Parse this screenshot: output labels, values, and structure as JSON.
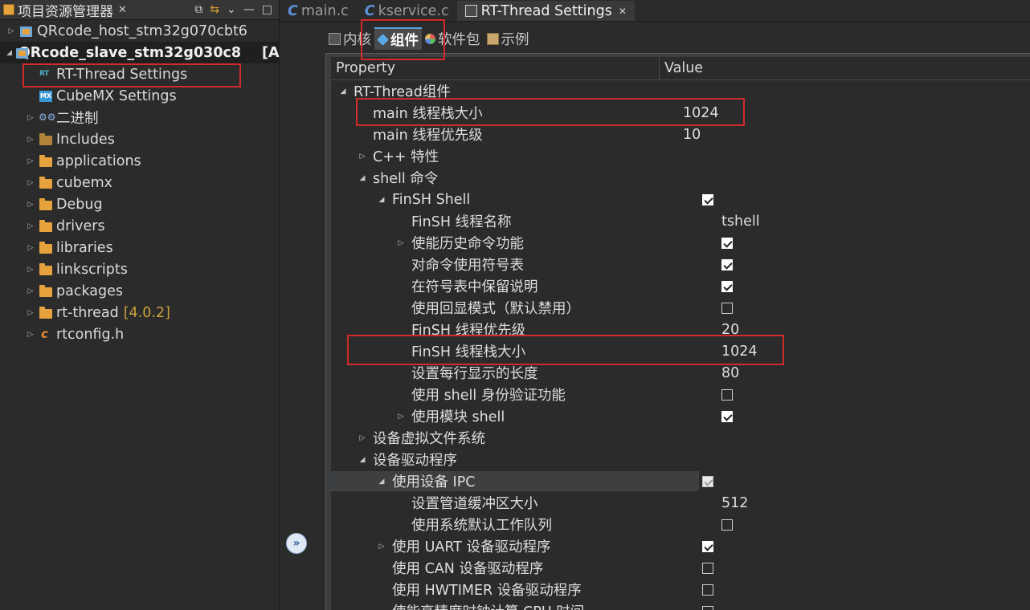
{
  "explorer": {
    "title": "项目资源管理器",
    "close_glyph": "✕",
    "items": [
      {
        "label": "QRcode_host_stm32g070cbt6",
        "kind": "project",
        "twisty": "▷",
        "bold": false
      },
      {
        "label": "QRcode_slave_stm32g030c8",
        "suffix": "[A",
        "kind": "project",
        "twisty": "◢",
        "bold": true
      },
      {
        "label": "RT-Thread Settings",
        "kind": "rt",
        "twisty": "",
        "bold": false
      },
      {
        "label": "CubeMX Settings",
        "kind": "mx",
        "twisty": "",
        "bold": false
      },
      {
        "label": "二进制",
        "kind": "binary",
        "twisty": "▷",
        "bold": false
      },
      {
        "label": "Includes",
        "kind": "folder-dark",
        "twisty": "▷",
        "bold": false
      },
      {
        "label": "applications",
        "kind": "folder",
        "twisty": "▷",
        "bold": false
      },
      {
        "label": "cubemx",
        "kind": "folder",
        "twisty": "▷",
        "bold": false
      },
      {
        "label": "Debug",
        "kind": "folder",
        "twisty": "▷",
        "bold": false
      },
      {
        "label": "drivers",
        "kind": "folder",
        "twisty": "▷",
        "bold": false
      },
      {
        "label": "libraries",
        "kind": "folder",
        "twisty": "▷",
        "bold": false
      },
      {
        "label": "linkscripts",
        "kind": "folder",
        "twisty": "▷",
        "bold": false
      },
      {
        "label": "packages",
        "kind": "folder",
        "twisty": "▷",
        "bold": false
      },
      {
        "label": "rt-thread",
        "version": "[4.0.2]",
        "kind": "folder",
        "twisty": "▷",
        "bold": false
      },
      {
        "label": "rtconfig.h",
        "kind": "cfile",
        "twisty": "▷",
        "bold": false
      }
    ]
  },
  "editor_tabs": [
    {
      "label": "main.c",
      "type": "c"
    },
    {
      "label": "kservice.c",
      "type": "c"
    },
    {
      "label": "RT-Thread Settings",
      "type": "settings",
      "close": "✕"
    }
  ],
  "sub_tabs": [
    {
      "label": "内核",
      "icon": "kernel"
    },
    {
      "label": "组件",
      "icon": "cube"
    },
    {
      "label": "软件包",
      "icon": "pkg"
    },
    {
      "label": "示例",
      "icon": "sample"
    }
  ],
  "table": {
    "col_property": "Property",
    "col_value": "Value",
    "rows": [
      {
        "label": "RT-Thread组件",
        "indent": 0,
        "twisty": "◢",
        "value": "",
        "check": null
      },
      {
        "label": "main 线程栈大小",
        "indent": 1,
        "twisty": "",
        "value": "1024",
        "check": null
      },
      {
        "label": "main 线程优先级",
        "indent": 1,
        "twisty": "",
        "value": "10",
        "check": null
      },
      {
        "label": "C++ 特性",
        "indent": 1,
        "twisty": "▷",
        "value": "",
        "check": null
      },
      {
        "label": "shell 命令",
        "indent": 1,
        "twisty": "◢",
        "value": "",
        "check": null
      },
      {
        "label": "FinSH Shell",
        "indent": 2,
        "twisty": "◢",
        "value": "",
        "check": "on"
      },
      {
        "label": "FinSH 线程名称",
        "indent": 3,
        "twisty": "",
        "value": "tshell",
        "check": null
      },
      {
        "label": "使能历史命令功能",
        "indent": 3,
        "twisty": "▷",
        "value": "",
        "check": "on"
      },
      {
        "label": "对命令使用符号表",
        "indent": 3,
        "twisty": "",
        "value": "",
        "check": "on"
      },
      {
        "label": "在符号表中保留说明",
        "indent": 3,
        "twisty": "",
        "value": "",
        "check": "on"
      },
      {
        "label": "使用回显模式（默认禁用）",
        "indent": 3,
        "twisty": "",
        "value": "",
        "check": "off"
      },
      {
        "label": "FinSH 线程优先级",
        "indent": 3,
        "twisty": "",
        "value": "20",
        "check": null
      },
      {
        "label": "FinSH 线程栈大小",
        "indent": 3,
        "twisty": "",
        "value": "1024",
        "check": null
      },
      {
        "label": "设置每行显示的长度",
        "indent": 3,
        "twisty": "",
        "value": "80",
        "check": null
      },
      {
        "label": "使用 shell 身份验证功能",
        "indent": 3,
        "twisty": "",
        "value": "",
        "check": "off"
      },
      {
        "label": "使用模块 shell",
        "indent": 3,
        "twisty": "▷",
        "value": "",
        "check": "on"
      },
      {
        "label": "设备虚拟文件系统",
        "indent": 1,
        "twisty": "▷",
        "value": "",
        "check": null
      },
      {
        "label": "设备驱动程序",
        "indent": 1,
        "twisty": "◢",
        "value": "",
        "check": null
      },
      {
        "label": "使用设备 IPC",
        "indent": 2,
        "twisty": "◢",
        "value": "",
        "check": "disabled",
        "highlight": true
      },
      {
        "label": "设置管道缓冲区大小",
        "indent": 3,
        "twisty": "",
        "value": "512",
        "check": null
      },
      {
        "label": "使用系统默认工作队列",
        "indent": 3,
        "twisty": "",
        "value": "",
        "check": "off"
      },
      {
        "label": "使用 UART 设备驱动程序",
        "indent": 2,
        "twisty": "▷",
        "value": "",
        "check": "on"
      },
      {
        "label": "使用 CAN 设备驱动程序",
        "indent": 2,
        "twisty": "",
        "value": "",
        "check": "off"
      },
      {
        "label": "使用 HWTIMER 设备驱动程序",
        "indent": 2,
        "twisty": "",
        "value": "",
        "check": "off"
      },
      {
        "label": "使能高精度时钟计算 CPU 时间",
        "indent": 2,
        "twisty": "",
        "value": "",
        "check": "off"
      }
    ]
  },
  "gutter_button": "»",
  "colors": {
    "annotation": "#d12b2b",
    "accent": "#5aa0e0"
  }
}
